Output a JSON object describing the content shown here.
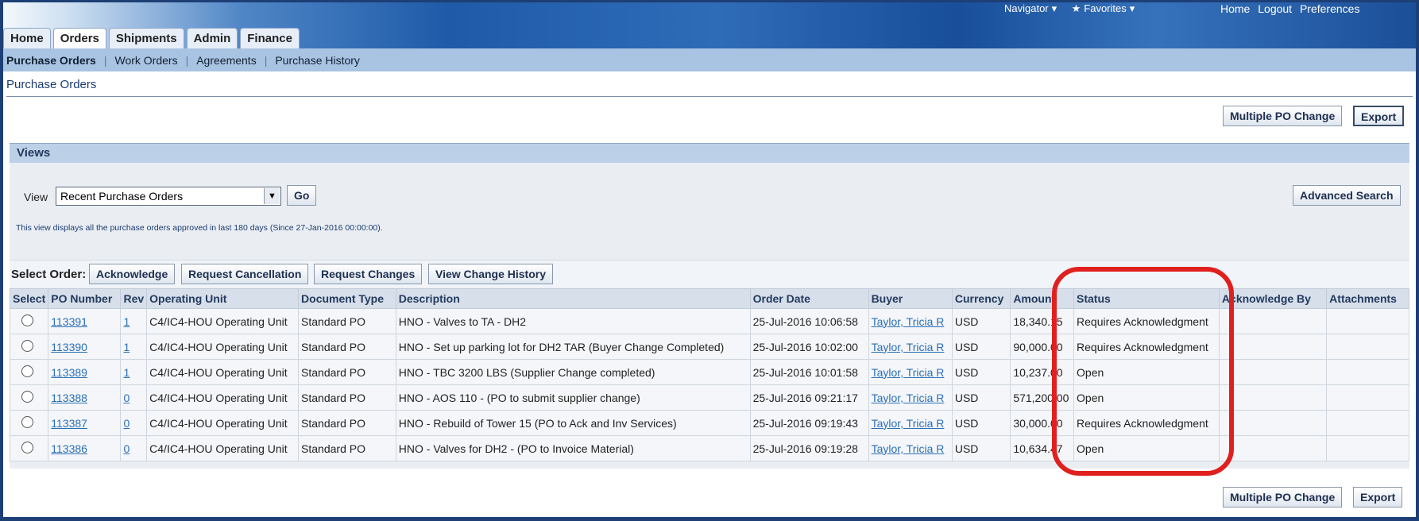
{
  "header": {
    "global_links": [
      "Navigator",
      "Favorites"
    ],
    "top_links": [
      "Home",
      "Logout",
      "Preferences"
    ]
  },
  "tabs": [
    "Home",
    "Orders",
    "Shipments",
    "Admin",
    "Finance"
  ],
  "subnav": [
    "Purchase Orders",
    "Work Orders",
    "Agreements",
    "Purchase History"
  ],
  "page_title": "Purchase Orders",
  "toolbar": {
    "multiple_po_change": "Multiple PO Change",
    "export": "Export"
  },
  "views": {
    "title": "Views",
    "view_label": "View",
    "selected_view": "Recent Purchase Orders",
    "go_label": "Go",
    "advanced_search": "Advanced Search",
    "note": "This view displays all the purchase orders approved in last 180 days (Since 27-Jan-2016 00:00:00)."
  },
  "actions": {
    "label": "Select Order:",
    "buttons": [
      "Acknowledge",
      "Request Cancellation",
      "Request Changes",
      "View Change History"
    ]
  },
  "table": {
    "columns": [
      "Select",
      "PO Number",
      "Rev",
      "Operating Unit",
      "Document Type",
      "Description",
      "Order Date",
      "Buyer",
      "Currency",
      "Amount",
      "Status",
      "Acknowledge By",
      "Attachments"
    ],
    "rows": [
      {
        "po": "113391",
        "rev": "1",
        "unit": "C4/IC4-HOU Operating Unit",
        "doc": "Standard PO",
        "desc": "HNO - Valves to TA - DH2",
        "date": "25-Jul-2016 10:06:58",
        "buyer": "Taylor, Tricia R",
        "currency": "USD",
        "amount": "18,340.15",
        "status": "Requires Acknowledgment",
        "ack": "",
        "att": ""
      },
      {
        "po": "113390",
        "rev": "1",
        "unit": "C4/IC4-HOU Operating Unit",
        "doc": "Standard PO",
        "desc": "HNO - Set up parking lot for DH2 TAR (Buyer Change Completed)",
        "date": "25-Jul-2016 10:02:00",
        "buyer": "Taylor, Tricia R",
        "currency": "USD",
        "amount": "90,000.00",
        "status": "Requires Acknowledgment",
        "ack": "",
        "att": ""
      },
      {
        "po": "113389",
        "rev": "1",
        "unit": "C4/IC4-HOU Operating Unit",
        "doc": "Standard PO",
        "desc": "HNO - TBC 3200 LBS (Supplier Change completed)",
        "date": "25-Jul-2016 10:01:58",
        "buyer": "Taylor, Tricia R",
        "currency": "USD",
        "amount": "10,237.00",
        "status": "Open",
        "ack": "",
        "att": ""
      },
      {
        "po": "113388",
        "rev": "0",
        "unit": "C4/IC4-HOU Operating Unit",
        "doc": "Standard PO",
        "desc": "HNO - AOS 110 - (PO to submit supplier change)",
        "date": "25-Jul-2016 09:21:17",
        "buyer": "Taylor, Tricia R",
        "currency": "USD",
        "amount": "571,200.00",
        "status": "Open",
        "ack": "",
        "att": ""
      },
      {
        "po": "113387",
        "rev": "0",
        "unit": "C4/IC4-HOU Operating Unit",
        "doc": "Standard PO",
        "desc": "HNO - Rebuild of Tower 15 (PO to Ack and Inv Services)",
        "date": "25-Jul-2016 09:19:43",
        "buyer": "Taylor, Tricia R",
        "currency": "USD",
        "amount": "30,000.00",
        "status": "Requires Acknowledgment",
        "ack": "",
        "att": ""
      },
      {
        "po": "113386",
        "rev": "0",
        "unit": "C4/IC4-HOU Operating Unit",
        "doc": "Standard PO",
        "desc": "HNO - Valves for DH2 - (PO to Invoice Material)",
        "date": "25-Jul-2016 09:19:28",
        "buyer": "Taylor, Tricia R",
        "currency": "USD",
        "amount": "10,634.47",
        "status": "Open",
        "ack": "",
        "att": ""
      }
    ]
  },
  "colors": {
    "highlight": "#e0201f",
    "link": "#2a6fb7",
    "banner": "#1e5aa8"
  }
}
